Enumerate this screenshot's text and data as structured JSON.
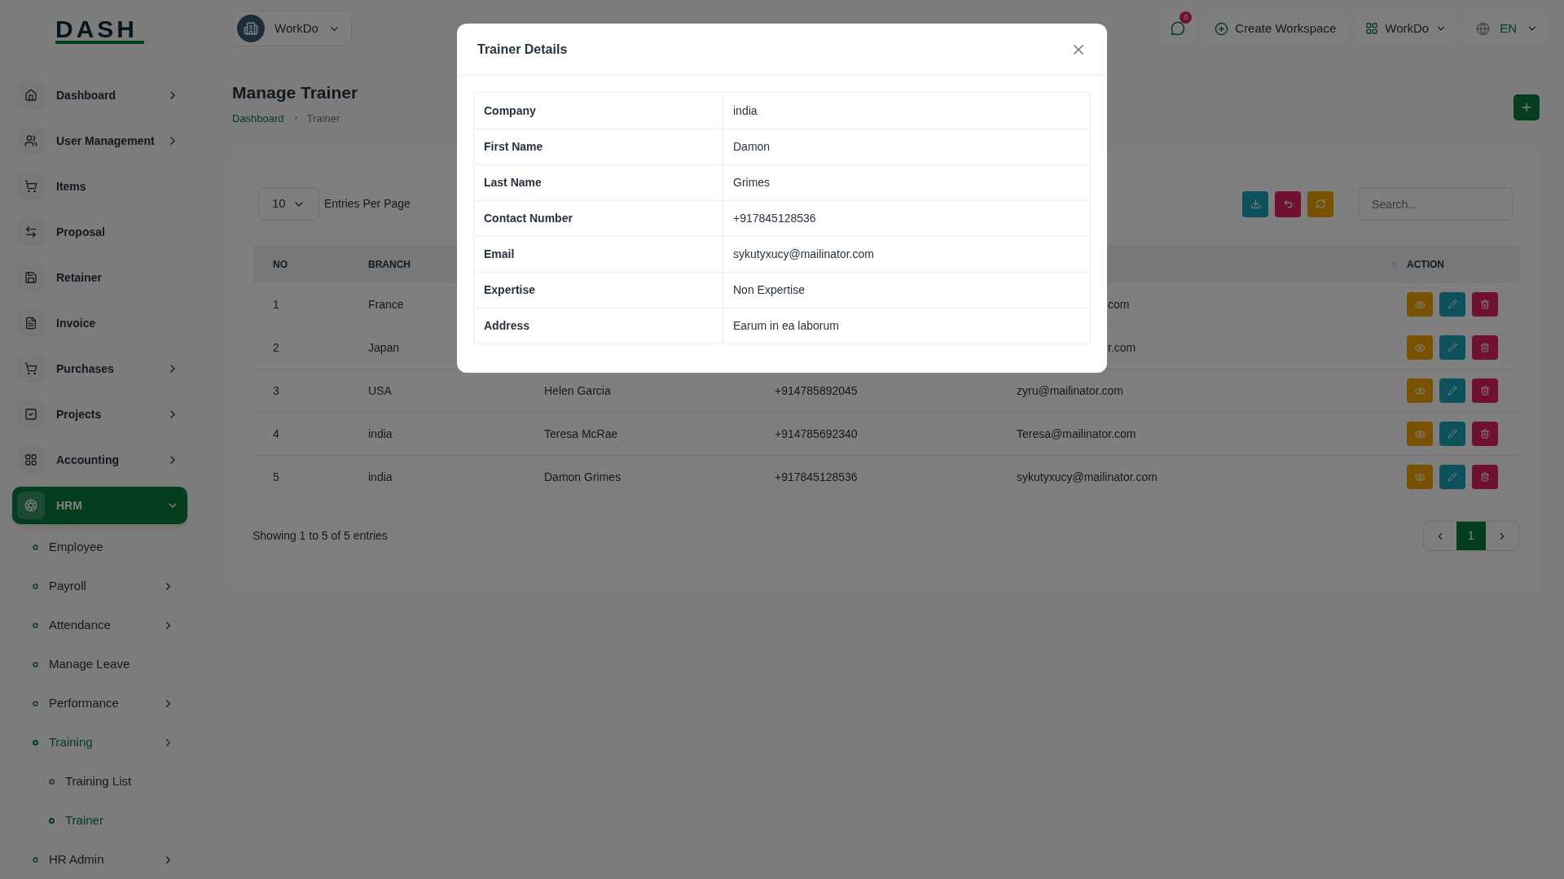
{
  "logo": "DASH",
  "sidebar": {
    "items": [
      {
        "label": "Dashboard",
        "has_arrow": true,
        "selected": false
      },
      {
        "label": "User Management",
        "has_arrow": true,
        "selected": false
      },
      {
        "label": "Items",
        "has_arrow": false,
        "selected": false
      },
      {
        "label": "Proposal",
        "has_arrow": false,
        "selected": false
      },
      {
        "label": "Retainer",
        "has_arrow": false,
        "selected": false
      },
      {
        "label": "Invoice",
        "has_arrow": false,
        "selected": false
      },
      {
        "label": "Purchases",
        "has_arrow": true,
        "selected": false
      },
      {
        "label": "Projects",
        "has_arrow": true,
        "selected": false
      },
      {
        "label": "Accounting",
        "has_arrow": true,
        "selected": false
      },
      {
        "label": "HRM",
        "has_arrow": true,
        "selected": true,
        "expanded": true,
        "children": [
          {
            "label": "Employee",
            "has_arrow": false,
            "selected": false
          },
          {
            "label": "Payroll",
            "has_arrow": true,
            "selected": false
          },
          {
            "label": "Attendance",
            "has_arrow": true,
            "selected": false
          },
          {
            "label": "Manage Leave",
            "has_arrow": false,
            "selected": false
          },
          {
            "label": "Performance",
            "has_arrow": true,
            "selected": false
          },
          {
            "label": "Training",
            "has_arrow": true,
            "selected": true,
            "children": [
              {
                "label": "Training List",
                "selected": false
              },
              {
                "label": "Trainer",
                "selected": true
              }
            ]
          },
          {
            "label": "HR Admin",
            "has_arrow": true,
            "selected": false
          }
        ]
      }
    ]
  },
  "header": {
    "workspace": "WorkDo",
    "notification_count": "0",
    "create_workspace": "Create Workspace",
    "workspace_menu": "WorkDo",
    "language": "EN"
  },
  "page": {
    "title": "Manage Trainer",
    "breadcrumbs": [
      "Dashboard",
      "Trainer"
    ]
  },
  "table": {
    "entries": "10",
    "entries_label": "Entries Per Page",
    "search": {
      "placeholder": "Search..."
    },
    "columns": [
      "NO",
      "BRANCH",
      "",
      "",
      "",
      "ACTION"
    ],
    "rows": [
      {
        "cells": [
          "1",
          "France",
          "",
          "",
          "com"
        ],
        "partly_hidden": true
      },
      {
        "cells": [
          "2",
          "Japan",
          "",
          "",
          "r.com"
        ],
        "partly_hidden": true
      },
      {
        "cells": [
          "3",
          "USA",
          "Helen Garcia",
          "+914785892045",
          "zyru@mailinator.com"
        ],
        "partly_hidden": false
      },
      {
        "cells": [
          "4",
          "india",
          "Teresa McRae",
          "+914785692340",
          "Teresa@mailinator.com"
        ],
        "partly_hidden": false
      },
      {
        "cells": [
          "5",
          "india",
          "Damon Grimes",
          "+917845128536",
          "sykutyxucy@mailinator.com"
        ],
        "partly_hidden": false
      }
    ],
    "footer": "Showing 1 to 5 of 5 entries",
    "pages": [
      {
        "label": "1",
        "selected": true
      }
    ]
  },
  "modal": {
    "title": "Trainer Details",
    "rows": [
      {
        "label": "Company",
        "value": "india"
      },
      {
        "label": "First Name",
        "value": "Damon"
      },
      {
        "label": "Last Name",
        "value": "Grimes"
      },
      {
        "label": "Contact Number",
        "value": "+917845128536"
      },
      {
        "label": "Email",
        "value": "sykutyxucy@mailinator.com"
      },
      {
        "label": "Expertise",
        "value": "Non Expertise"
      },
      {
        "label": "Address",
        "value": "Earum in ea laborum"
      }
    ]
  }
}
